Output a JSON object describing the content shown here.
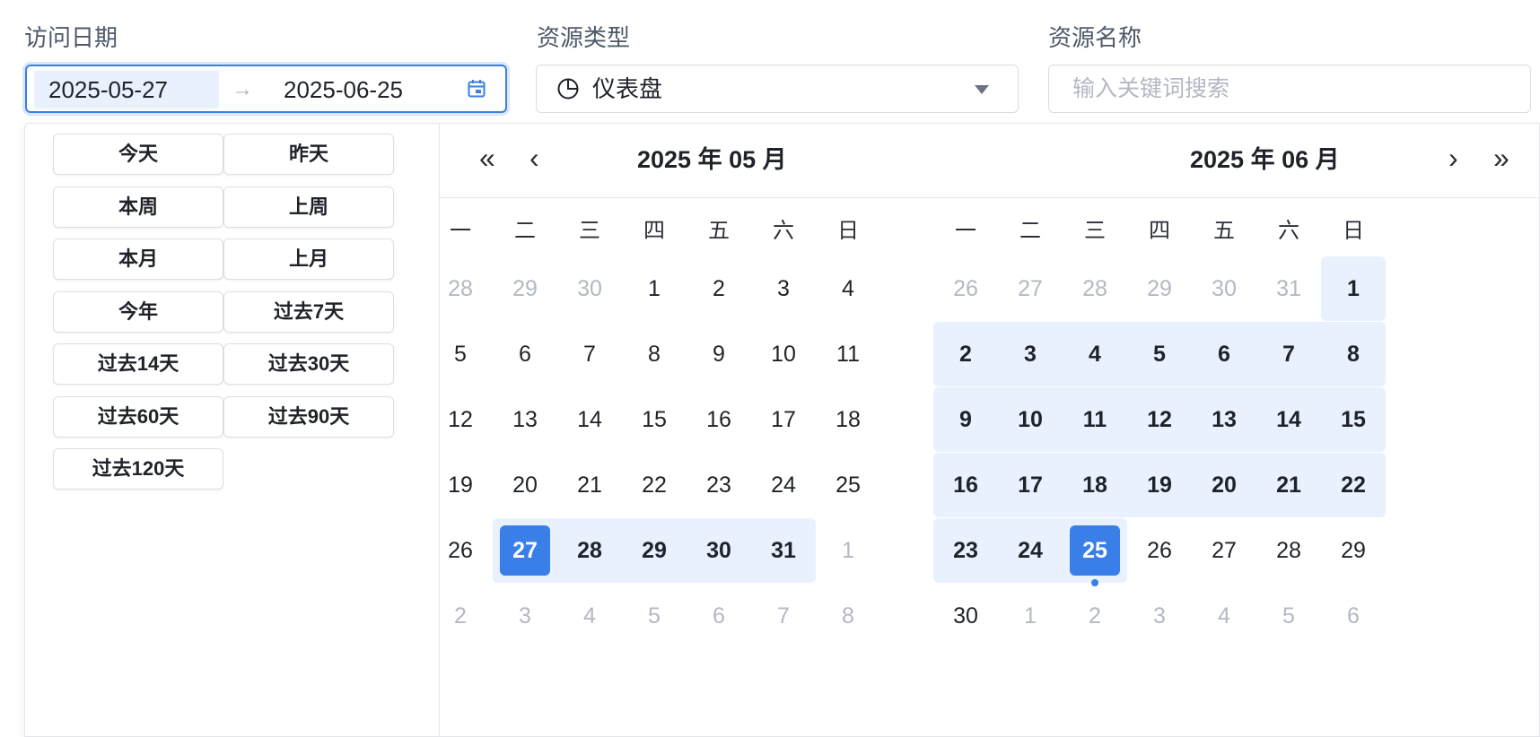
{
  "filters": {
    "visit_date_label": "访问日期",
    "resource_type_label": "资源类型",
    "resource_name_label": "资源名称",
    "date_start": "2025-05-27",
    "range_separator": "→",
    "date_end": "2025-06-25",
    "resource_type_value": "仪表盘",
    "resource_name_placeholder": "输入关键词搜索"
  },
  "presets": [
    "今天",
    "昨天",
    "本周",
    "上周",
    "本月",
    "上月",
    "今年",
    "过去7天",
    "过去14天",
    "过去30天",
    "过去60天",
    "过去90天",
    "过去120天"
  ],
  "weekdays": [
    "一",
    "二",
    "三",
    "四",
    "五",
    "六",
    "日"
  ],
  "calendars": [
    {
      "title": "2025 年 05 月",
      "days": [
        [
          [
            "28",
            0
          ],
          [
            "29",
            0
          ],
          [
            "30",
            0
          ],
          [
            "1",
            1
          ],
          [
            "2",
            1
          ],
          [
            "3",
            1
          ],
          [
            "4",
            1
          ]
        ],
        [
          [
            "5",
            1
          ],
          [
            "6",
            1
          ],
          [
            "7",
            1
          ],
          [
            "8",
            1
          ],
          [
            "9",
            1
          ],
          [
            "10",
            1
          ],
          [
            "11",
            1
          ]
        ],
        [
          [
            "12",
            1
          ],
          [
            "13",
            1
          ],
          [
            "14",
            1
          ],
          [
            "15",
            1
          ],
          [
            "16",
            1
          ],
          [
            "17",
            1
          ],
          [
            "18",
            1
          ]
        ],
        [
          [
            "19",
            1
          ],
          [
            "20",
            1
          ],
          [
            "21",
            1
          ],
          [
            "22",
            1
          ],
          [
            "23",
            1
          ],
          [
            "24",
            1
          ],
          [
            "25",
            1
          ]
        ],
        [
          [
            "26",
            1
          ],
          [
            "27",
            1
          ],
          [
            "28",
            1
          ],
          [
            "29",
            1
          ],
          [
            "30",
            1
          ],
          [
            "31",
            1
          ],
          [
            "1",
            0
          ]
        ],
        [
          [
            "2",
            0
          ],
          [
            "3",
            0
          ],
          [
            "4",
            0
          ],
          [
            "5",
            0
          ],
          [
            "6",
            0
          ],
          [
            "7",
            0
          ],
          [
            "8",
            0
          ]
        ]
      ]
    },
    {
      "title": "2025 年 06 月",
      "days": [
        [
          [
            "26",
            0
          ],
          [
            "27",
            0
          ],
          [
            "28",
            0
          ],
          [
            "29",
            0
          ],
          [
            "30",
            0
          ],
          [
            "31",
            0
          ],
          [
            "1",
            1
          ]
        ],
        [
          [
            "2",
            1
          ],
          [
            "3",
            1
          ],
          [
            "4",
            1
          ],
          [
            "5",
            1
          ],
          [
            "6",
            1
          ],
          [
            "7",
            1
          ],
          [
            "8",
            1
          ]
        ],
        [
          [
            "9",
            1
          ],
          [
            "10",
            1
          ],
          [
            "11",
            1
          ],
          [
            "12",
            1
          ],
          [
            "13",
            1
          ],
          [
            "14",
            1
          ],
          [
            "15",
            1
          ]
        ],
        [
          [
            "16",
            1
          ],
          [
            "17",
            1
          ],
          [
            "18",
            1
          ],
          [
            "19",
            1
          ],
          [
            "20",
            1
          ],
          [
            "21",
            1
          ],
          [
            "22",
            1
          ]
        ],
        [
          [
            "23",
            1
          ],
          [
            "24",
            1
          ],
          [
            "25",
            1
          ],
          [
            "26",
            1
          ],
          [
            "27",
            1
          ],
          [
            "28",
            1
          ],
          [
            "29",
            1
          ]
        ],
        [
          [
            "30",
            1
          ],
          [
            "1",
            0
          ],
          [
            "2",
            0
          ],
          [
            "3",
            0
          ],
          [
            "4",
            0
          ],
          [
            "5",
            0
          ],
          [
            "6",
            0
          ]
        ]
      ]
    }
  ],
  "selection": {
    "start": {
      "calendar": 0,
      "row": 4,
      "col": 1
    },
    "end": {
      "calendar": 1,
      "row": 4,
      "col": 2
    },
    "today": {
      "calendar": 1,
      "row": 4,
      "col": 2
    }
  },
  "colors": {
    "accent": "#3a7ee8",
    "range_bg": "#e8f1fd",
    "muted_text": "#b3b8c2"
  },
  "icons": {
    "calendar": "calendar-icon",
    "pie": "pie-chart-icon",
    "dropdown": "caret-down-icon",
    "prev_year": "double-chevron-left-icon",
    "prev_month": "chevron-left-icon",
    "next_month": "chevron-right-icon",
    "next_year": "double-chevron-right-icon"
  }
}
